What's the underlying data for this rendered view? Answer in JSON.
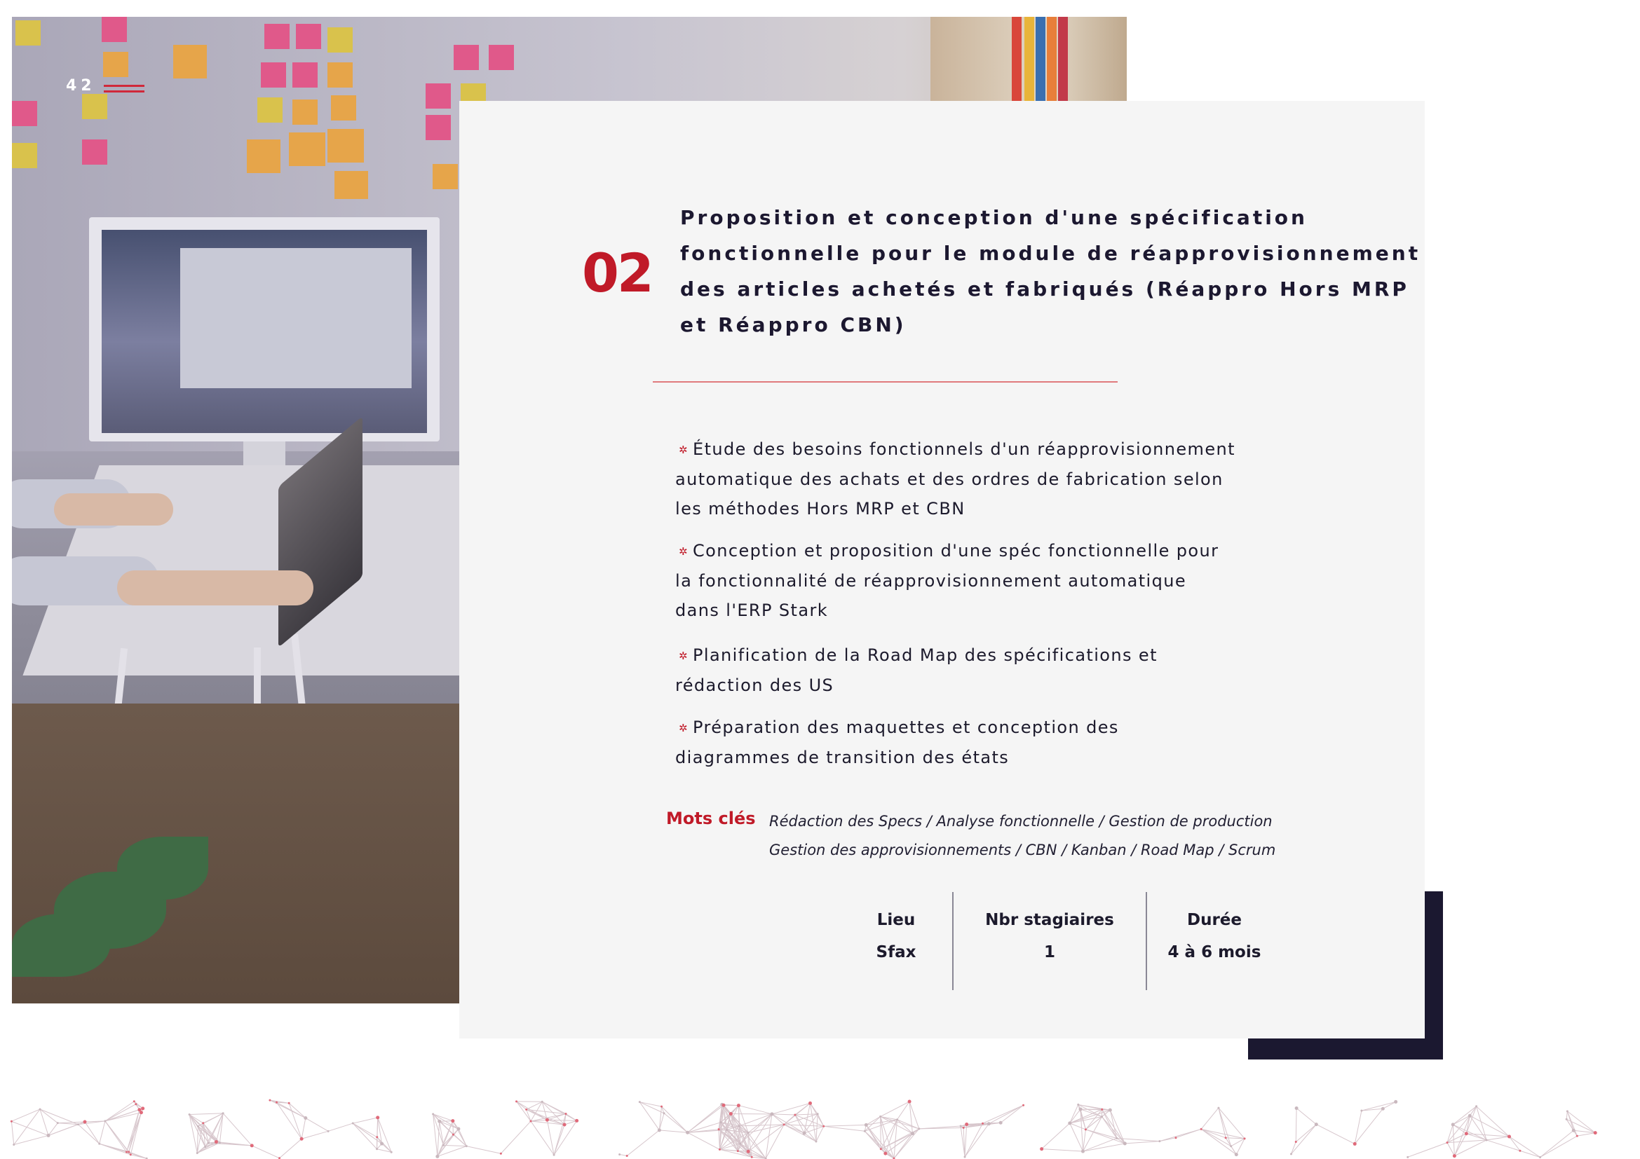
{
  "page": {
    "number": "42"
  },
  "section": {
    "number": "02",
    "title_lines": [
      "Proposition et conception d'une spécification",
      "fonctionnelle pour le module de réapprovisionnement",
      "des articles achetés et fabriqués (Réappro Hors MRP",
      "et Réappro CBN)"
    ]
  },
  "bullets": [
    {
      "lines": [
        "Étude des besoins fonctionnels  d'un réapprovisionnement",
        "automatique des achats et des ordres de fabrication selon",
        "les méthodes Hors MRP et  CBN"
      ]
    },
    {
      "lines": [
        "Conception et proposition d'une spéc fonctionnelle pour",
        "la fonctionnalité de réapprovisionnement automatique",
        "dans l'ERP Stark"
      ]
    },
    {
      "lines": [
        "Planification de la Road Map des spécifications et",
        "rédaction des US"
      ]
    },
    {
      "lines": [
        "Préparation des maquettes et conception des",
        "diagrammes de transition des états"
      ]
    }
  ],
  "keywords": {
    "label": "Mots clés",
    "lines": [
      "Rédaction des Specs / Analyse fonctionnelle / Gestion de production",
      "Gestion des approvisionnements / CBN / Kanban / Road Map / Scrum"
    ]
  },
  "info": {
    "location": {
      "label": "Lieu",
      "value": "Sfax"
    },
    "interns": {
      "label": "Nbr stagiaires",
      "value": "1"
    },
    "duration": {
      "label": "Durée",
      "value": "4 à 6 mois"
    }
  },
  "colors": {
    "accent": "#c01a28",
    "dark": "#1b1830",
    "card": "#f5f5f5"
  },
  "icons": {
    "bullet": "star-bullet-icon"
  }
}
